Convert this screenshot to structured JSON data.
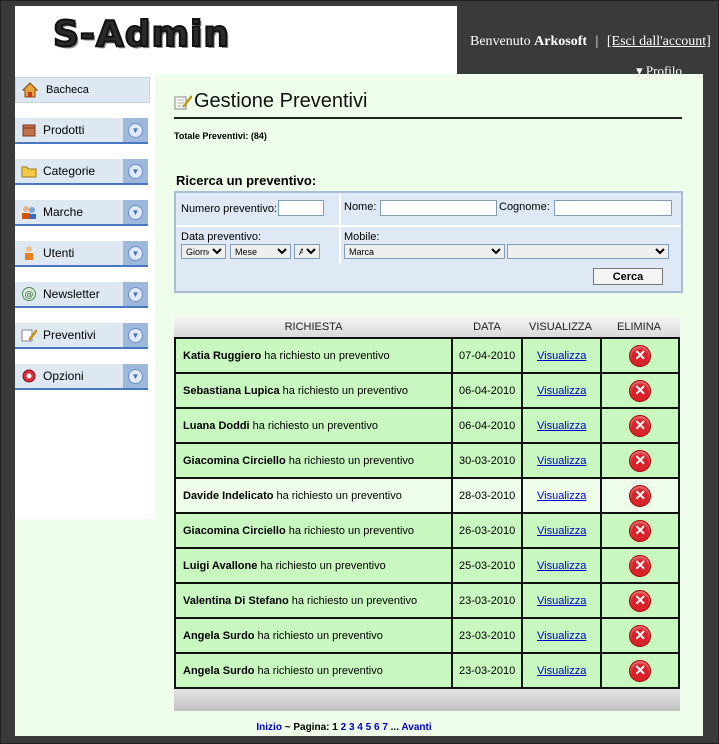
{
  "header": {
    "logo": "S-Admin",
    "welcome_prefix": "Benvenuto",
    "user": "Arkosoft",
    "separator": "|",
    "logout": "[Esci dall'account]",
    "profile": "▾ Profilo"
  },
  "sidebar": {
    "home": "Bacheca",
    "items": [
      {
        "label": "Prodotti",
        "icon": "box-icon"
      },
      {
        "label": "Categorie",
        "icon": "folder-icon"
      },
      {
        "label": "Marche",
        "icon": "users-icon"
      },
      {
        "label": "Utenti",
        "icon": "user-icon"
      },
      {
        "label": "Newsletter",
        "icon": "mail-icon"
      },
      {
        "label": "Preventivi",
        "icon": "edit-icon"
      },
      {
        "label": "Opzioni",
        "icon": "gear-icon"
      }
    ]
  },
  "main": {
    "title": "Gestione Preventivi",
    "total": "Totale Preventivi: (84)",
    "search": {
      "title": "Ricerca un preventivo:",
      "numero_label": "Numero preventivo:",
      "nome_label": "Nome:",
      "cognome_label": "Cognome:",
      "data_label": "Data preventivo:",
      "giorno": "Giorno",
      "mese": "Mese",
      "anno": "Anno",
      "mobile_label": "Mobile:",
      "marca": "Marca",
      "button": "Cerca"
    },
    "table": {
      "headers": [
        "RICHIESTA",
        "DATA",
        "VISUALIZZA",
        "ELIMINA"
      ],
      "action_text": "ha richiesto un preventivo",
      "view_text": "Visualizza",
      "rows": [
        {
          "name": "Katia Ruggiero",
          "date": "07-04-2010"
        },
        {
          "name": "Sebastiana Lupica",
          "date": "06-04-2010"
        },
        {
          "name": "Luana Doddi",
          "date": "06-04-2010"
        },
        {
          "name": "Giacomina Circiello",
          "date": "30-03-2010"
        },
        {
          "name": "Davide Indelicato",
          "date": "28-03-2010"
        },
        {
          "name": "Giacomina Circiello",
          "date": "26-03-2010"
        },
        {
          "name": "Luigi Avallone",
          "date": "25-03-2010"
        },
        {
          "name": "Valentina Di Stefano",
          "date": "23-03-2010"
        },
        {
          "name": "Angela Surdo",
          "date": "23-03-2010"
        },
        {
          "name": "Angela Surdo",
          "date": "23-03-2010"
        }
      ]
    },
    "pager": {
      "start": "Inizio",
      "label": "~ Pagina:",
      "current": "1",
      "pages": [
        "2",
        "3",
        "4",
        "5",
        "6",
        "7"
      ],
      "more": "...",
      "next": "Avanti"
    }
  }
}
